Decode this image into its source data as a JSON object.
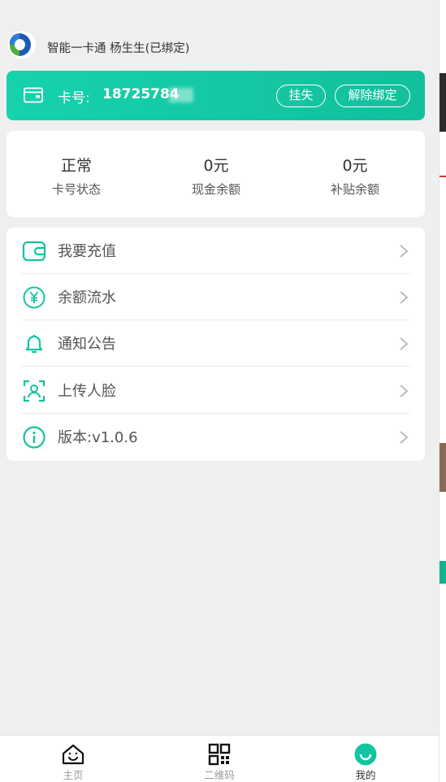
{
  "header": {
    "title": "智能一卡通 杨生生(已绑定)"
  },
  "card": {
    "label": "卡号:",
    "number": "18725784",
    "report_loss": "挂失",
    "unbind": "解除绑定"
  },
  "stats": [
    {
      "value": "正常",
      "label": "卡号状态"
    },
    {
      "value": "0元",
      "label": "现金余额"
    },
    {
      "value": "0元",
      "label": "补贴余额"
    }
  ],
  "menu": [
    {
      "label": "我要充值",
      "icon": "wallet-icon"
    },
    {
      "label": "余额流水",
      "icon": "yen-circle-icon"
    },
    {
      "label": "通知公告",
      "icon": "bell-icon"
    },
    {
      "label": "上传人脸",
      "icon": "face-scan-icon"
    },
    {
      "label": "版本:v1.0.6",
      "icon": "info-icon"
    }
  ],
  "tabbar": [
    {
      "label": "主页",
      "icon": "home-icon",
      "active": false
    },
    {
      "label": "二维码",
      "icon": "qr-code-icon",
      "active": false
    },
    {
      "label": "我的",
      "icon": "profile-smile-icon",
      "active": true
    }
  ],
  "colors": {
    "accent": "#12c49f",
    "accent_light": "#16d2ad",
    "background": "#efefef",
    "text": "#333333",
    "muted": "#999999"
  }
}
